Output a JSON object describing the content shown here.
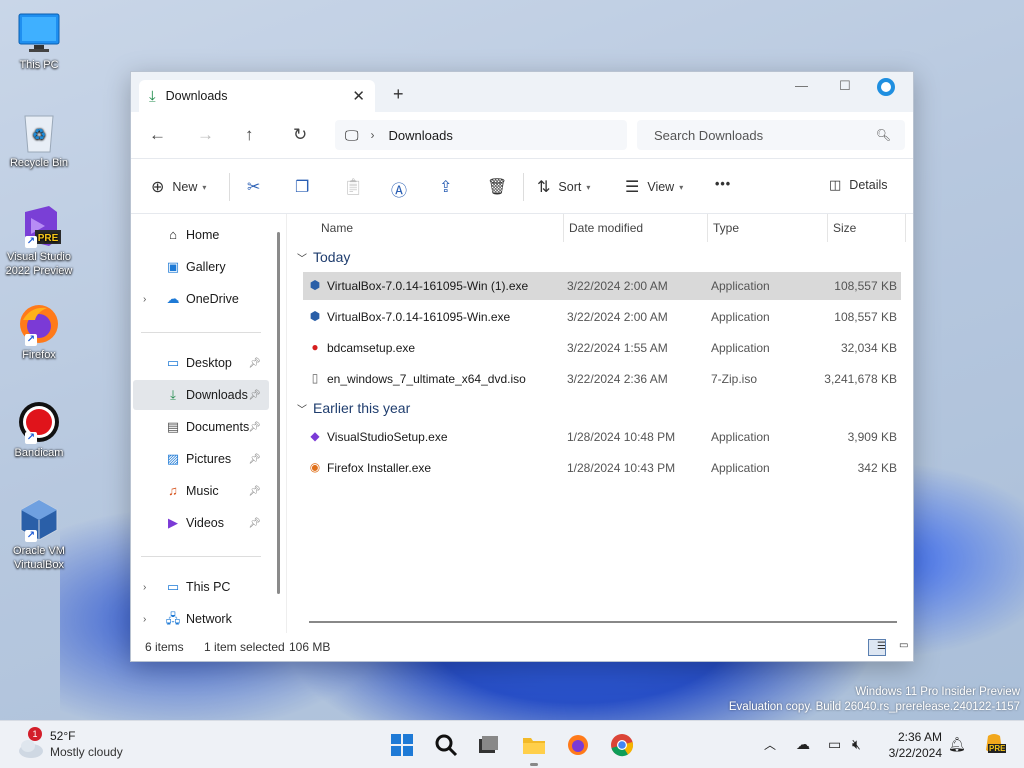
{
  "desktop": {
    "icons": [
      {
        "label": "This PC"
      },
      {
        "label": "Recycle Bin"
      },
      {
        "label": "Visual Studio 2022 Preview"
      },
      {
        "label": "Firefox"
      },
      {
        "label": "Bandicam"
      },
      {
        "label": "Oracle VM VirtualBox"
      }
    ],
    "vs_badge": "PRE",
    "watermark_line1": "Windows 11 Pro Insider Preview",
    "watermark_line2": "Evaluation copy. Build 26040.rs_prerelease.240122-1157"
  },
  "window": {
    "tab_title": "Downloads",
    "address": {
      "crumb": "Downloads"
    },
    "search_placeholder": "Search Downloads",
    "toolbar": {
      "new_label": "New",
      "sort_label": "Sort",
      "view_label": "View",
      "more_label": "•••",
      "details_label": "Details"
    },
    "nav": {
      "items": [
        {
          "label": "Home"
        },
        {
          "label": "Gallery"
        },
        {
          "label": "OneDrive"
        },
        {
          "label": "Desktop"
        },
        {
          "label": "Downloads"
        },
        {
          "label": "Documents"
        },
        {
          "label": "Pictures"
        },
        {
          "label": "Music"
        },
        {
          "label": "Videos"
        },
        {
          "label": "This PC"
        },
        {
          "label": "Network"
        }
      ]
    },
    "columns": {
      "name": "Name",
      "date": "Date modified",
      "type": "Type",
      "size": "Size"
    },
    "groups": [
      {
        "label": "Today"
      },
      {
        "label": "Earlier this year"
      }
    ],
    "files": [
      {
        "name": "VirtualBox-7.0.14-161095-Win (1).exe",
        "date": "3/22/2024 2:00 AM",
        "type": "Application",
        "size": "108,557 KB"
      },
      {
        "name": "VirtualBox-7.0.14-161095-Win.exe",
        "date": "3/22/2024 2:00 AM",
        "type": "Application",
        "size": "108,557 KB"
      },
      {
        "name": "bdcamsetup.exe",
        "date": "3/22/2024 1:55 AM",
        "type": "Application",
        "size": "32,034 KB"
      },
      {
        "name": "en_windows_7_ultimate_x64_dvd.iso",
        "date": "3/22/2024 2:36 AM",
        "type": "7-Zip.iso",
        "size": "3,241,678 KB"
      },
      {
        "name": "VisualStudioSetup.exe",
        "date": "1/28/2024 10:48 PM",
        "type": "Application",
        "size": "3,909 KB"
      },
      {
        "name": "Firefox Installer.exe",
        "date": "1/28/2024 10:43 PM",
        "type": "Application",
        "size": "342 KB"
      }
    ],
    "status": {
      "count": "6 items",
      "selected": "1 item selected",
      "size": "106 MB"
    }
  },
  "taskbar": {
    "weather_badge": "1",
    "temp": "52°F",
    "condition": "Mostly cloudy",
    "time": "2:36 AM",
    "date": "3/22/2024",
    "copilot_badge": "PRE"
  },
  "colors": {
    "accent": "#0067c0",
    "selected_row": "#d9d9d9",
    "taskbar": "#eef1f6"
  }
}
